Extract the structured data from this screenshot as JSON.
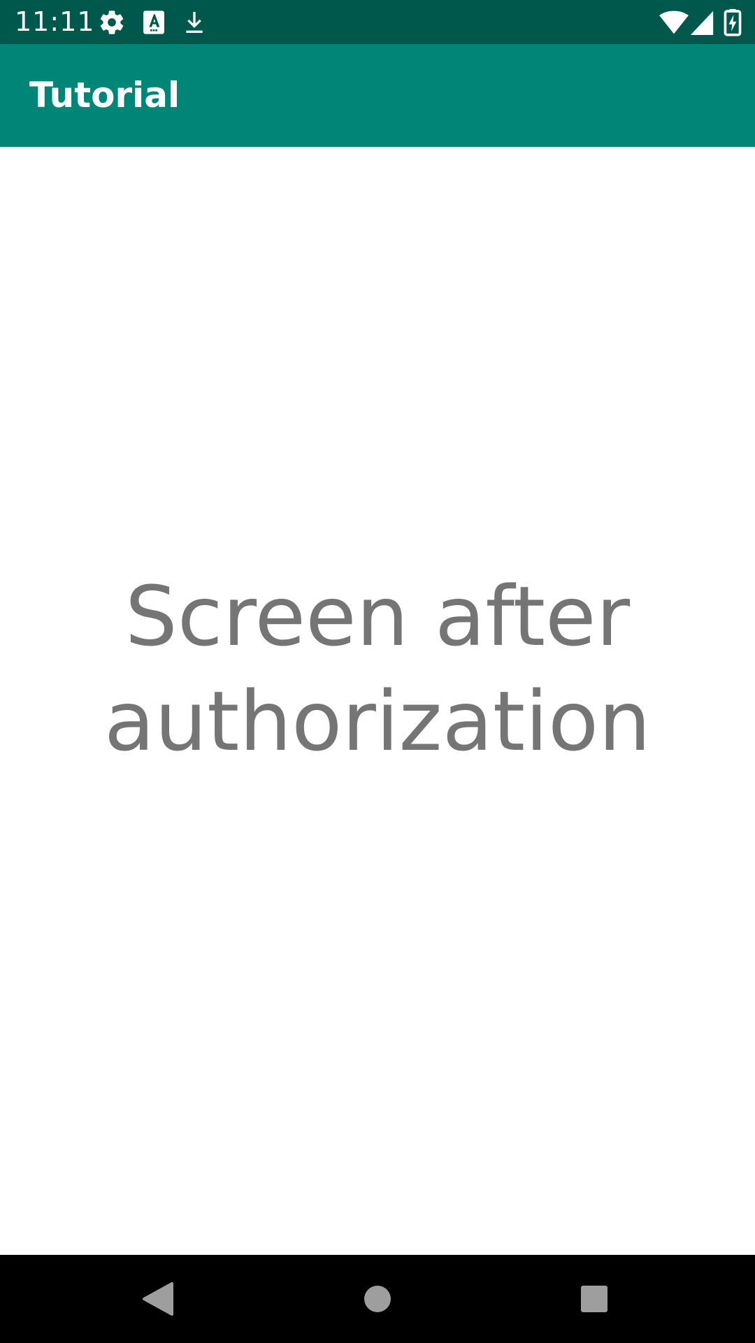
{
  "status_bar": {
    "time": "11:11",
    "icons": [
      "settings-icon",
      "font-a-icon",
      "download-icon",
      "wifi-icon",
      "cell-signal-icon",
      "battery-charging-icon"
    ]
  },
  "app_bar": {
    "title": "Tutorial"
  },
  "content": {
    "message": "Screen after\nauthorization"
  },
  "nav_bar": {
    "buttons": [
      "back-icon",
      "home-icon",
      "recents-icon"
    ]
  },
  "colors": {
    "status_bar": "#00574b",
    "app_bar": "#008577",
    "message_text": "#757575",
    "nav_bar": "#000000"
  }
}
